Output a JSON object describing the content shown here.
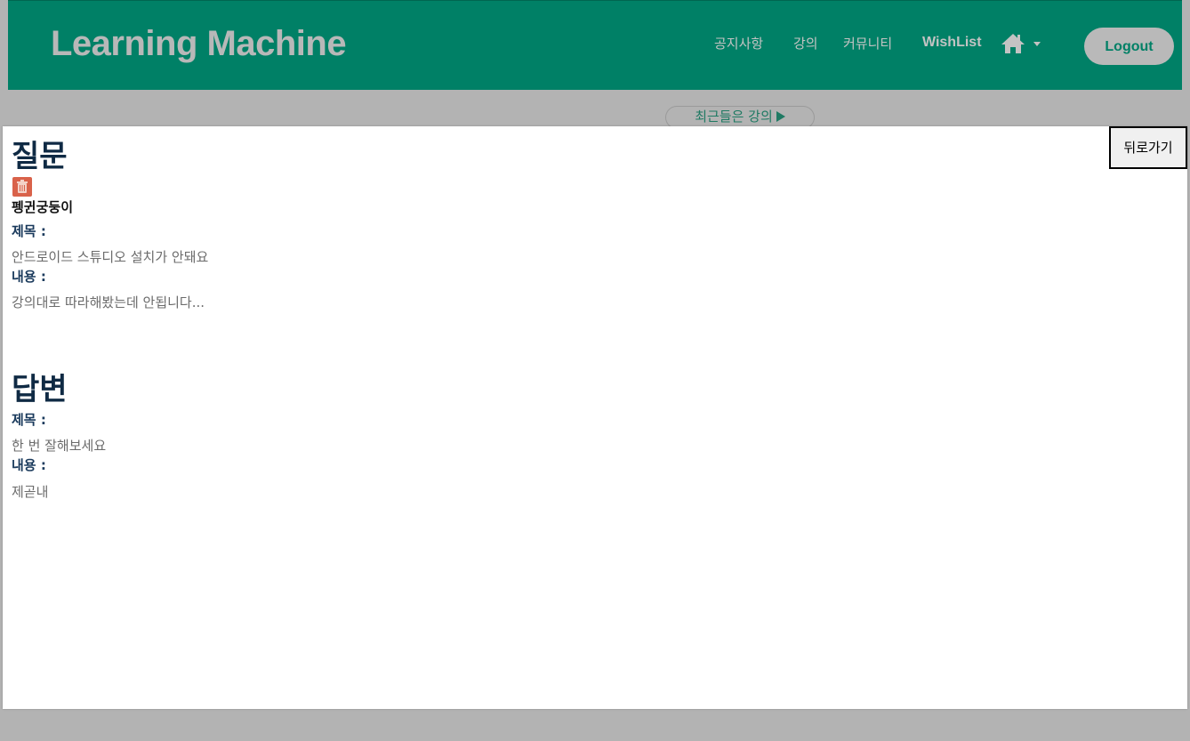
{
  "navbar": {
    "brand": "Learning Machine",
    "links": [
      "공지사항",
      "강의",
      "커뮤니티"
    ],
    "wishlist": "WishList",
    "home_icon": "home-icon",
    "logout_label": "Logout"
  },
  "recent": {
    "label": "최근들은 강의"
  },
  "modal": {
    "back_label": "뒤로가기",
    "question": {
      "heading": "질문",
      "delete_icon": "trash-icon",
      "author": "펭귄궁둥이",
      "title_label": "제목 :",
      "title_value": "안드로이드 스튜디오 설치가 안돼요",
      "content_label": "내용 :",
      "content_value": "강의대로 따라해봤는데 안됩니다..."
    },
    "answer": {
      "heading": "답변",
      "title_label": "제목 :",
      "title_value": "한 번 잘해보세요",
      "content_label": "내용 :",
      "content_value": "제곧내"
    }
  },
  "colors": {
    "navbar": "#008066",
    "overlay": "#b3b3b3",
    "heading": "#0f2a44"
  }
}
